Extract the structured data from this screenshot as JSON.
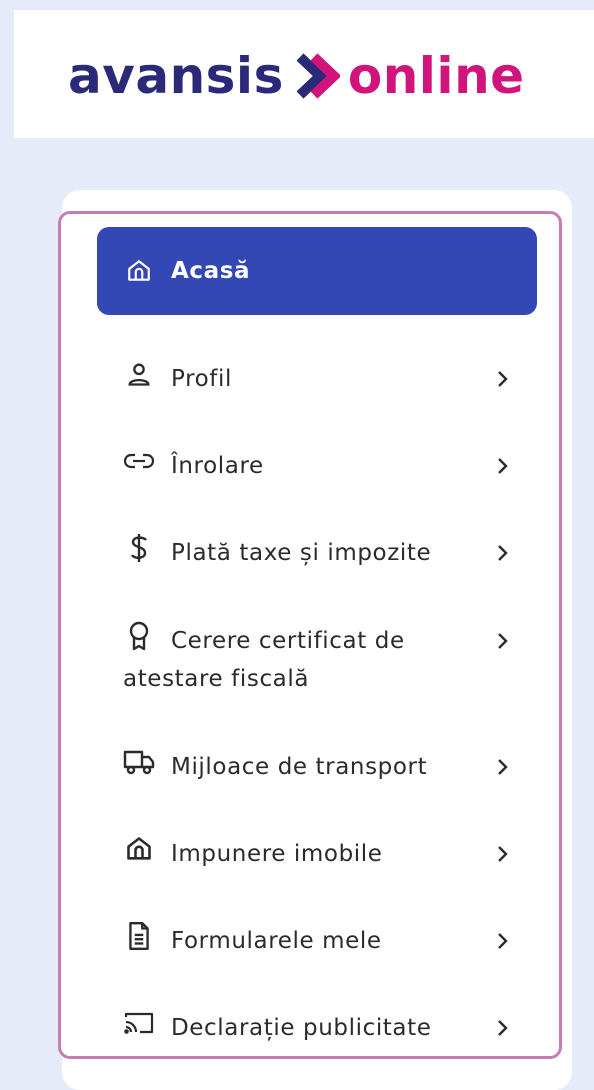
{
  "brand": {
    "name_left": "avansis",
    "name_right": "online",
    "colors": {
      "primary": "#2a2a78",
      "accent": "#d1147c"
    }
  },
  "menu": {
    "highlight_color": "#c77cb4",
    "active_color": "#3347b5",
    "items": [
      {
        "label": "Acasă",
        "icon": "home-icon",
        "active": true
      },
      {
        "label": "Profil",
        "icon": "user-icon"
      },
      {
        "label": "Înrolare",
        "icon": "link-icon"
      },
      {
        "label": "Plată taxe și impozite",
        "icon": "dollar-icon"
      },
      {
        "label_line1": "Cerere certificat de",
        "label_line2": "atestare fiscală",
        "icon": "certificate-icon"
      },
      {
        "label": "Mijloace de transport",
        "icon": "truck-icon"
      },
      {
        "label": "Impunere imobile",
        "icon": "house-icon"
      },
      {
        "label": "Formularele mele",
        "icon": "document-icon"
      },
      {
        "label": "Declarație publicitate",
        "icon": "cast-icon"
      }
    ]
  }
}
